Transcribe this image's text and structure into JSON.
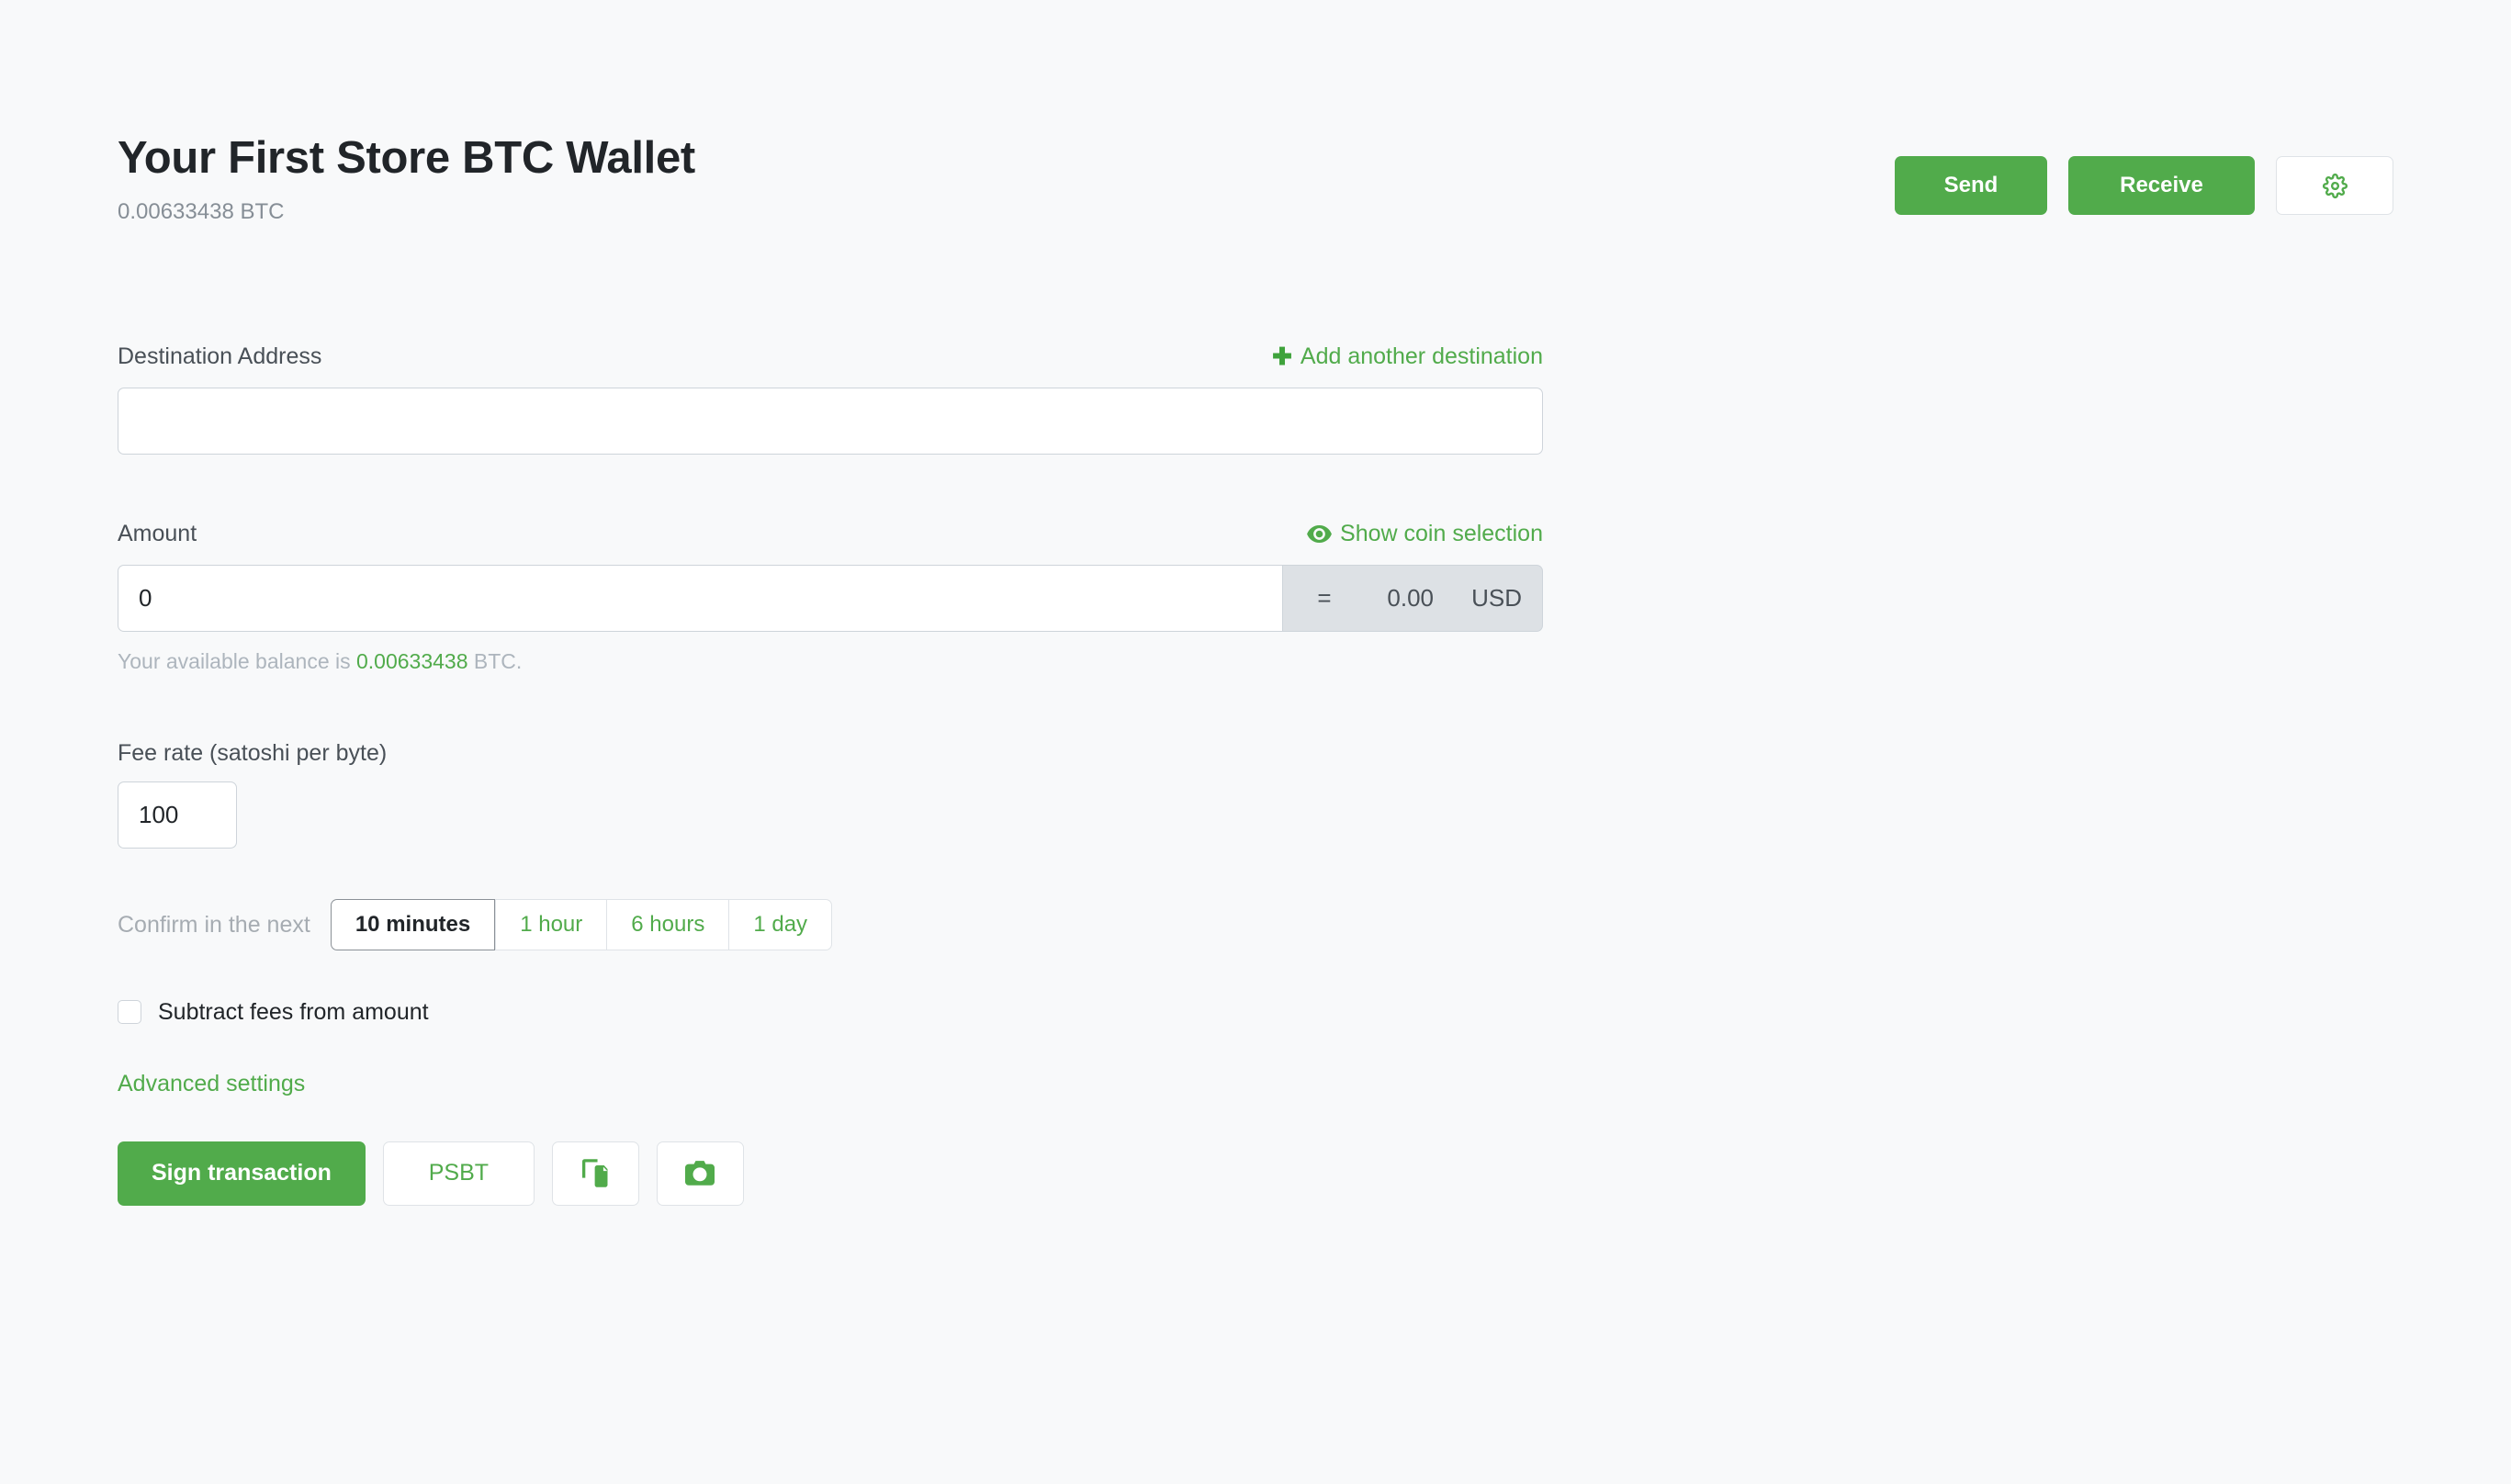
{
  "header": {
    "title": "Your First Store BTC Wallet",
    "balance": "0.00633438 BTC",
    "send_label": "Send",
    "receive_label": "Receive",
    "settings_icon": "gear-icon"
  },
  "form": {
    "destination": {
      "label": "Destination Address",
      "add_link": "Add another destination",
      "add_icon": "plus-icon",
      "value": "",
      "placeholder": ""
    },
    "amount": {
      "label": "Amount",
      "coin_selection_link": "Show coin selection",
      "coin_selection_icon": "eye-icon",
      "value": "0",
      "equals_sign": "=",
      "fiat_value": "0.00",
      "fiat_currency": "USD",
      "helper_prefix": "Your available balance is",
      "helper_amount": "0.00633438",
      "helper_suffix": "BTC."
    },
    "fee": {
      "label": "Fee rate (satoshi per byte)",
      "value": "100"
    },
    "confirm": {
      "label": "Confirm in the next",
      "options": [
        {
          "label": "10 minutes",
          "active": true
        },
        {
          "label": "1 hour",
          "active": false
        },
        {
          "label": "6 hours",
          "active": false
        },
        {
          "label": "1 day",
          "active": false
        }
      ]
    },
    "subtract_fees": {
      "label": "Subtract fees from amount",
      "checked": false
    },
    "advanced_settings": "Advanced settings",
    "actions": {
      "sign_label": "Sign transaction",
      "psbt_label": "PSBT",
      "paste_icon": "paste-icon",
      "camera_icon": "camera-icon"
    }
  },
  "colors": {
    "accent_green": "#51ab4b",
    "page_background": "#f8f9fa",
    "border": "#ced4da",
    "addon_background": "#dde1e5",
    "muted_text": "#868e96"
  }
}
